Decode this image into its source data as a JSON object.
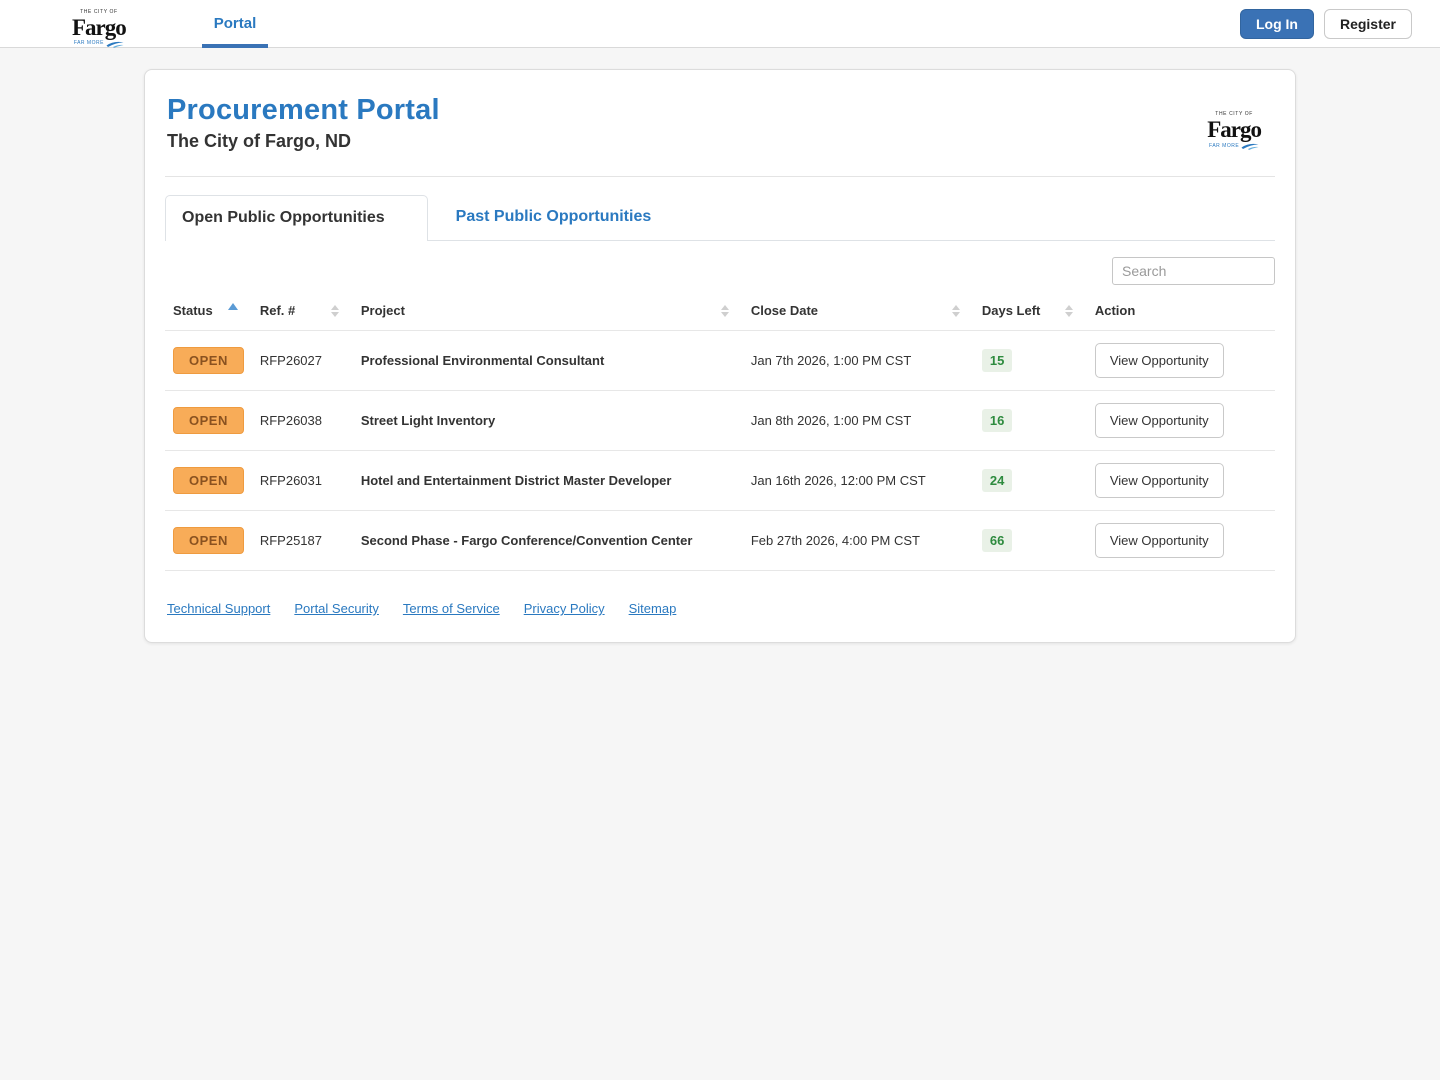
{
  "nav": {
    "brand": {
      "top": "THE CITY OF",
      "name": "Fargo",
      "tagline": "FAR MORE"
    },
    "portal_label": "Portal",
    "login_label": "Log In",
    "register_label": "Register"
  },
  "card": {
    "title": "Procurement Portal",
    "subtitle": "The City of Fargo, ND",
    "tabs": [
      {
        "label": "Open Public Opportunities",
        "active": true
      },
      {
        "label": "Past Public Opportunities",
        "active": false
      }
    ],
    "search_placeholder": "Search",
    "table": {
      "columns": [
        {
          "label": "Status",
          "sort": "asc"
        },
        {
          "label": "Ref. #",
          "sort": "both"
        },
        {
          "label": "Project",
          "sort": "both"
        },
        {
          "label": "Close Date",
          "sort": "both"
        },
        {
          "label": "Days Left",
          "sort": "both"
        },
        {
          "label": "Action",
          "sort": "none"
        }
      ],
      "rows": [
        {
          "status": "OPEN",
          "ref": "RFP26027",
          "project": "Professional Environmental Consultant",
          "close_date": "Jan 7th 2026, 1:00 PM CST",
          "days_left": "15",
          "action": "View Opportunity"
        },
        {
          "status": "OPEN",
          "ref": "RFP26038",
          "project": "Street Light Inventory",
          "close_date": "Jan 8th 2026, 1:00 PM CST",
          "days_left": "16",
          "action": "View Opportunity"
        },
        {
          "status": "OPEN",
          "ref": "RFP26031",
          "project": "Hotel and Entertainment District Master Developer",
          "close_date": "Jan 16th 2026, 12:00 PM CST",
          "days_left": "24",
          "action": "View Opportunity"
        },
        {
          "status": "OPEN",
          "ref": "RFP25187",
          "project": "Second Phase - Fargo Conference/Convention Center",
          "close_date": "Feb 27th 2026, 4:00 PM CST",
          "days_left": "66",
          "action": "View Opportunity"
        }
      ]
    },
    "footer_links": [
      "Technical Support",
      "Portal Security",
      "Terms of Service",
      "Privacy Policy",
      "Sitemap"
    ]
  },
  "colors": {
    "brand_blue": "#2a79c0",
    "button_blue": "#3a72b5",
    "status_open_bg": "#f8ac58",
    "status_open_border": "#ef9b3f",
    "status_open_text": "#8a5220",
    "days_left_bg": "#e9f1e7",
    "days_left_text": "#2e8b3f",
    "page_bg": "#f6f6f6"
  }
}
